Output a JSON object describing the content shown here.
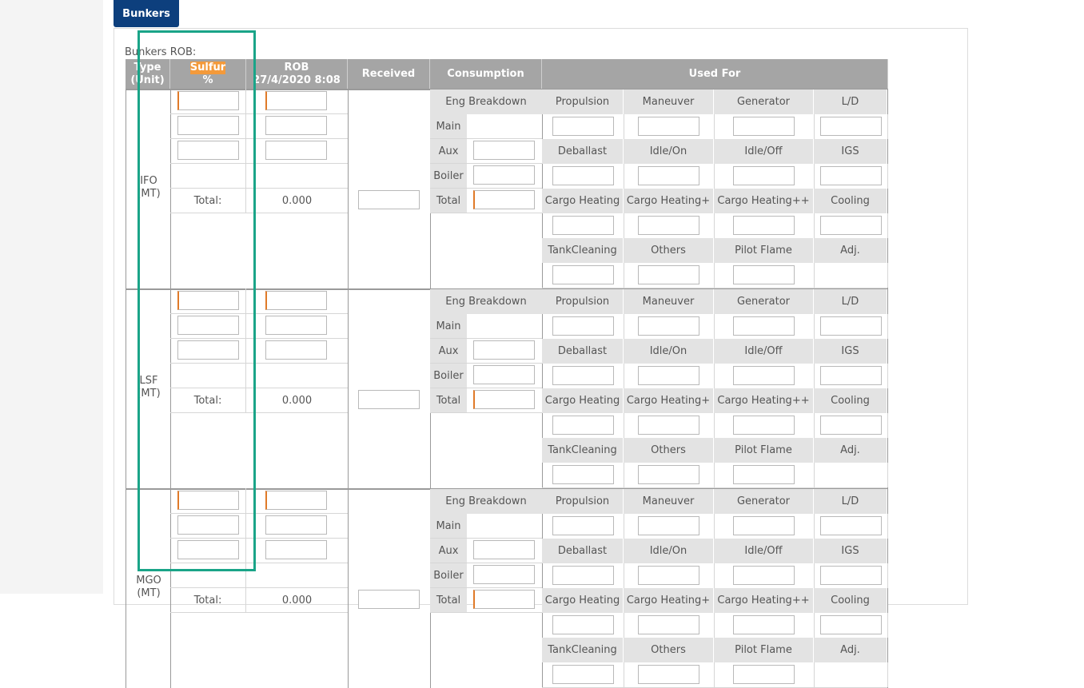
{
  "tab": {
    "label": "Bunkers"
  },
  "section_label": "Bunkers ROB:",
  "headers": {
    "type": "Type",
    "unit": "(Unit)",
    "sulfur": "Sulfur",
    "pct": "%",
    "rob": "ROB",
    "rob_date": "27/4/2020 8:08",
    "received": "Received",
    "consumption": "Consumption",
    "used_for": "Used For"
  },
  "groups": [
    {
      "name": "IFO",
      "unit": "(MT)",
      "total_label": "Total:",
      "total_value": "0.000"
    },
    {
      "name": "LSF",
      "unit": "(MT)",
      "total_label": "Total:",
      "total_value": "0.000"
    },
    {
      "name": "MGO",
      "unit": "(MT)",
      "total_label": "Total:",
      "total_value": "0.000"
    }
  ],
  "consumption_labels": {
    "eng_breakdown": "Eng Breakdown",
    "main": "Main",
    "aux": "Aux",
    "boiler": "Boiler",
    "total": "Total"
  },
  "used_for_labels": {
    "row1": [
      "Propulsion",
      "Maneuver",
      "Generator",
      "L/D"
    ],
    "row2": [
      "Deballast",
      "Idle/On",
      "Idle/Off",
      "IGS"
    ],
    "row3": [
      "Cargo Heating",
      "Cargo Heating+",
      "Cargo Heating++",
      "Cooling"
    ],
    "row4": [
      "TankCleaning",
      "Others",
      "Pilot Flame",
      "Adj."
    ]
  }
}
